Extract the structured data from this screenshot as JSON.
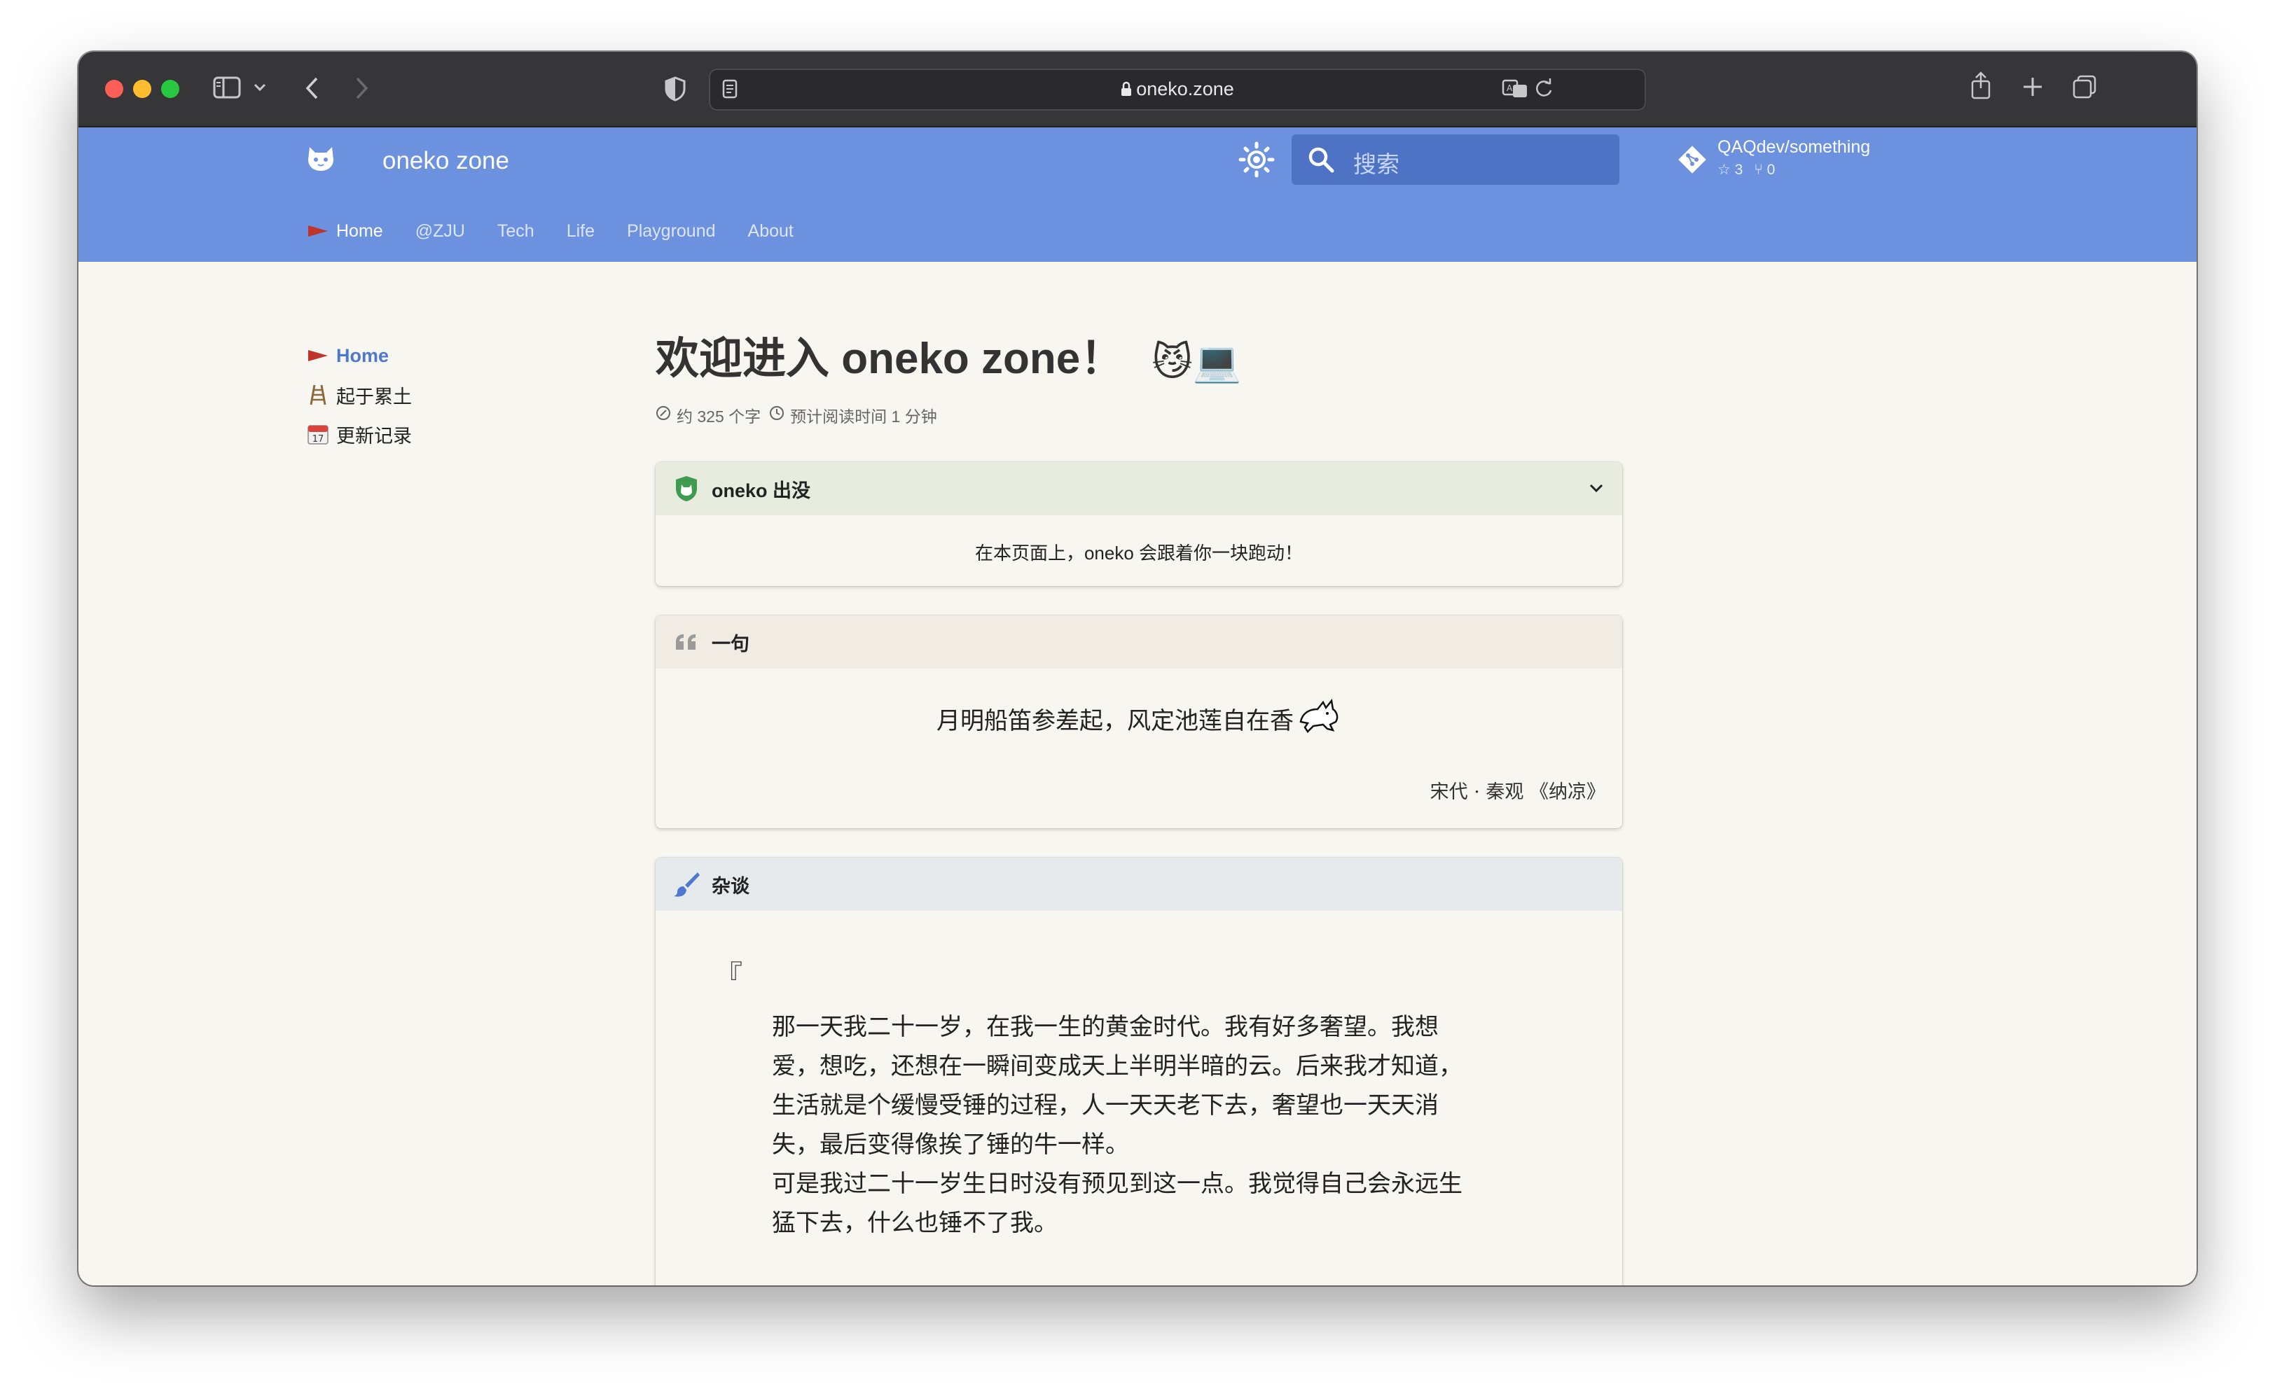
{
  "browser": {
    "url": "oneko.zone",
    "icons": [
      "sidebar-icon",
      "chevron-down-icon",
      "back-icon",
      "forward-icon",
      "shield-icon",
      "reader-icon",
      "lock-icon",
      "translate-icon",
      "reload-icon",
      "share-icon",
      "new-tab-icon",
      "tabs-overview-icon"
    ]
  },
  "site": {
    "title": "oneko zone",
    "search_placeholder": "搜索",
    "repo": {
      "name": "QAQdev/something",
      "stars": "3",
      "forks": "0"
    },
    "nav": [
      {
        "label": "Home",
        "active": true
      },
      {
        "label": "@ZJU",
        "active": false
      },
      {
        "label": "Tech",
        "active": false
      },
      {
        "label": "Life",
        "active": false
      },
      {
        "label": "Playground",
        "active": false
      },
      {
        "label": "About",
        "active": false
      }
    ],
    "accent": "#6b91df"
  },
  "sidebar": {
    "items": [
      {
        "label": "Home",
        "icon": "flag-icon",
        "active": true
      },
      {
        "label": "起于累土",
        "icon": "ladder-icon",
        "active": false
      },
      {
        "label": "更新记录",
        "icon": "calendar-icon",
        "active": false
      }
    ]
  },
  "page": {
    "title": "欢迎进入 oneko zone！",
    "title_emoji": "😼💻",
    "word_count": "约 325 个字",
    "read_time": "预计阅读时间 1 分钟"
  },
  "admonitions": {
    "oneko": {
      "title": "oneko 出没",
      "body": "在本页面上，oneko 会跟着你一块跑动！"
    },
    "quote": {
      "title": "一句",
      "text": "月明船笛参差起，风定池莲自在香",
      "source": "宋代 · 秦观  《纳凉》"
    },
    "essay": {
      "title": "杂谈",
      "open_mark": "『",
      "close_mark": "』",
      "paragraphs": [
        "那一天我二十一岁，在我一生的黄金时代。我有好多奢望。我想",
        "爱，想吃，还想在一瞬间变成天上半明半暗的云。后来我才知道，",
        "生活就是个缓慢受锤的过程，人一天天老下去，奢望也一天天消",
        "失，最后变得像挨了锤的牛一样。",
        "可是我过二十一岁生日时没有预见到这一点。我觉得自己会永远生",
        "猛下去，什么也锤不了我。"
      ]
    }
  }
}
